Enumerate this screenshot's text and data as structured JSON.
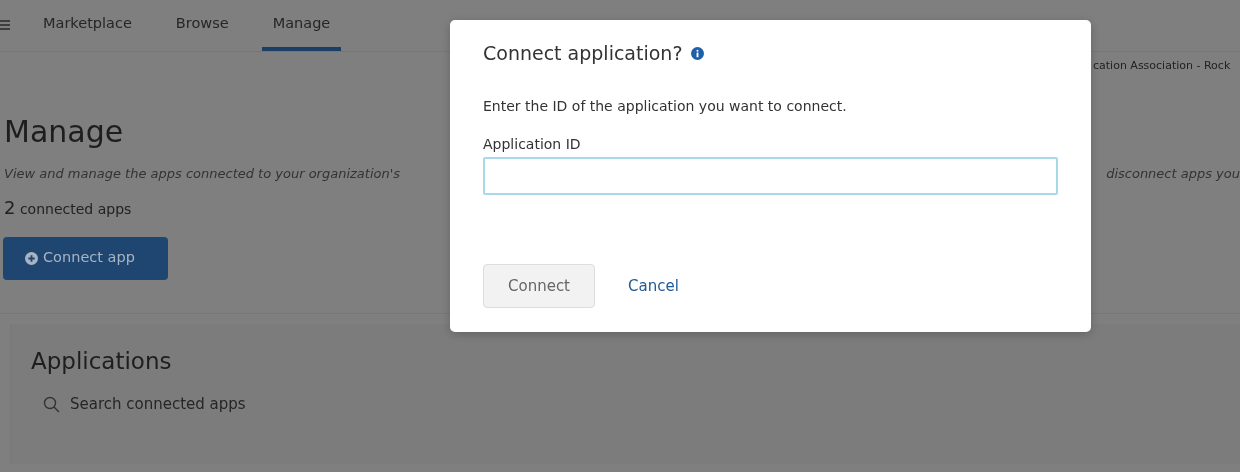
{
  "nav": {
    "tabs": [
      {
        "label": "Marketplace",
        "selected": false
      },
      {
        "label": "Browse",
        "selected": false
      },
      {
        "label": "Manage",
        "selected": true
      }
    ]
  },
  "org_name": "cation Association - Rock",
  "page": {
    "title": "Manage",
    "description_left": "View and manage the apps connected to your organization's",
    "description_right": "disconnect apps you",
    "count": "2",
    "count_label": "connected apps",
    "connect_button": "Connect app"
  },
  "applications": {
    "title": "Applications",
    "search": {
      "placeholder": "Search connected apps"
    }
  },
  "dialog": {
    "title": "Connect application?",
    "message": "Enter the ID of the application you want to connect.",
    "field_label": "Application ID",
    "field_focused": true,
    "buttons": [
      {
        "label": "Connect",
        "kind": "secondary",
        "disabled": true
      },
      {
        "label": "Cancel",
        "kind": "link",
        "disabled": false
      }
    ]
  }
}
